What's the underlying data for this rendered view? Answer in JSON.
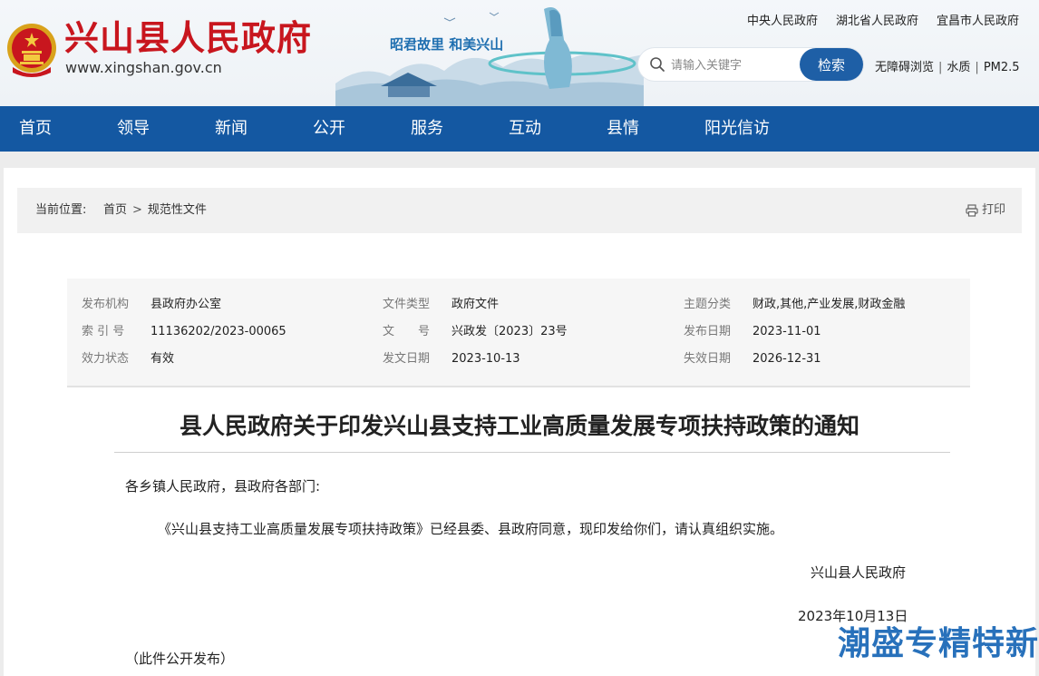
{
  "header": {
    "site_name": "兴山县人民政府",
    "site_url": "www.xingshan.gov.cn",
    "slogan": "昭君故里  和美兴山",
    "top_links": [
      "中央人民政府",
      "湖北省人民政府",
      "宜昌市人民政府"
    ],
    "search": {
      "placeholder": "请输入关键字",
      "button": "检索"
    },
    "utilities": [
      "无障碍浏览",
      "水质",
      "PM2.5"
    ]
  },
  "nav": {
    "items": [
      "首页",
      "领导",
      "新闻",
      "公开",
      "服务",
      "互动",
      "县情",
      "阳光信访"
    ]
  },
  "breadcrumb": {
    "label": "当前位置:",
    "items": [
      "首页",
      "规范性文件"
    ],
    "print": "打印"
  },
  "meta": {
    "rows": [
      [
        {
          "k": "发布机构",
          "v": "县政府办公室"
        },
        {
          "k": "文件类型",
          "v": "政府文件"
        },
        {
          "k": "主题分类",
          "v": "财政,其他,产业发展,财政金融"
        }
      ],
      [
        {
          "k": "索 引 号",
          "v": "11136202/2023-00065"
        },
        {
          "k": "文　　号",
          "v": "兴政发〔2023〕23号"
        },
        {
          "k": "发布日期",
          "v": "2023-11-01"
        }
      ],
      [
        {
          "k": "效力状态",
          "v": "有效"
        },
        {
          "k": "发文日期",
          "v": "2023-10-13"
        },
        {
          "k": "失效日期",
          "v": "2026-12-31"
        }
      ]
    ]
  },
  "article": {
    "title": "县人民政府关于印发兴山县支持工业高质量发展专项扶持政策的通知",
    "salutation": "各乡镇人民政府，县政府各部门:",
    "body": "《兴山县支持工业高质量发展专项扶持政策》已经县委、县政府同意，现印发给你们，请认真组织实施。",
    "signature": "兴山县人民政府",
    "date": "2023年10月13日",
    "note": "（此件公开发布）"
  },
  "watermark": "潮盛专精特新",
  "colors": {
    "nav_bg": "#1458a2",
    "site_name": "#c8161e",
    "search_button": "#1e5fa6"
  }
}
